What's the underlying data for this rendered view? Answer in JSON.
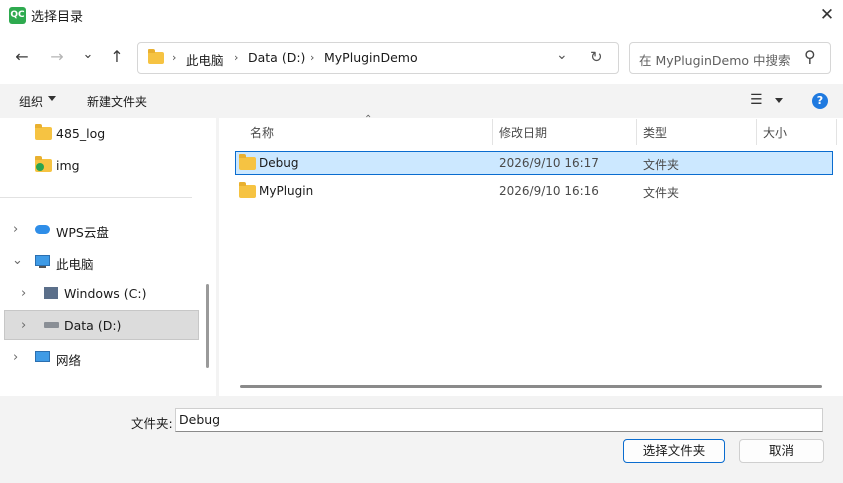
{
  "window": {
    "title": "选择目录",
    "app_icon_text": "QC",
    "close_glyph": "✕"
  },
  "nav": {
    "back": "←",
    "forward": "→",
    "history": "⌄",
    "up": "↑",
    "breadcrumb": [
      "此电脑",
      "Data (D:)",
      "MyPluginDemo"
    ],
    "sep": "›",
    "dropdown": "⌄",
    "refresh": "↻",
    "search_placeholder": "在 MyPluginDemo 中搜索",
    "search_glyph": "⚲"
  },
  "toolbar": {
    "organize": "组织",
    "new_folder": "新建文件夹",
    "view_glyph": "☰",
    "help": "?"
  },
  "tree": {
    "quick": [
      {
        "label": "485_log"
      },
      {
        "label": "img"
      }
    ],
    "items": [
      {
        "label": "WPS云盘",
        "chevron": "›"
      },
      {
        "label": "此电脑",
        "chevron": "⌄"
      },
      {
        "label": "Windows (C:)",
        "chevron": "›"
      },
      {
        "label": "Data (D:)",
        "chevron": "›"
      },
      {
        "label": "网络",
        "chevron": "›"
      }
    ]
  },
  "files": {
    "columns": [
      "名称",
      "修改日期",
      "类型",
      "大小"
    ],
    "sort_indicator": "⌃",
    "rows": [
      {
        "name": "Debug",
        "date": "2026/9/10 16:17",
        "type": "文件夹",
        "size": ""
      },
      {
        "name": "MyPlugin",
        "date": "2026/9/10 16:16",
        "type": "文件夹",
        "size": ""
      }
    ]
  },
  "footer": {
    "folder_label": "文件夹:",
    "folder_value": "Debug",
    "select_button": "选择文件夹",
    "cancel_button": "取消"
  },
  "colors": {
    "accent": "#0a6ccf",
    "selection": "#cce8ff",
    "folder": "#f6c342"
  }
}
